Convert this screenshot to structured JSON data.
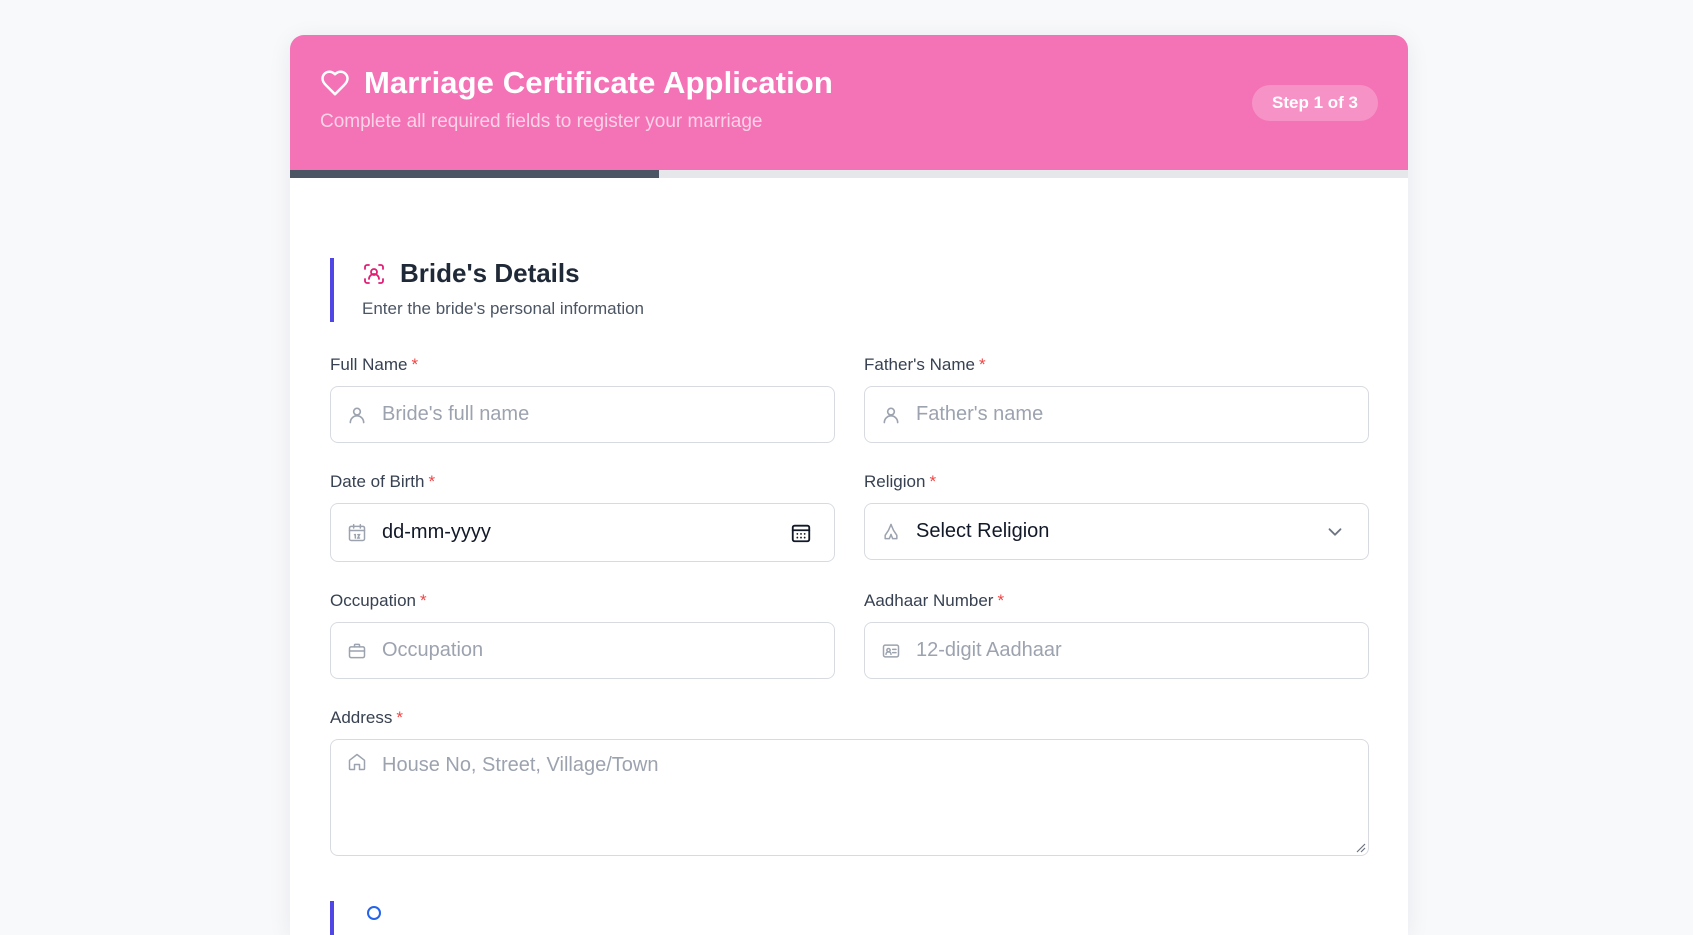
{
  "header": {
    "title": "Marriage Certificate Application",
    "subtitle": "Complete all required fields to register your marriage",
    "step_badge": "Step 1 of 3",
    "progress_fraction": 0.33,
    "colors": {
      "header_bg": "#f472b6",
      "progress_fill": "#4b5563",
      "accent": "#4f46e5"
    },
    "icon": "heart-icon"
  },
  "section": {
    "title": "Bride's Details",
    "subtitle": "Enter the bride's personal information",
    "icon": "user-scan-icon"
  },
  "form": {
    "full_name": {
      "label": "Full Name",
      "required": "*",
      "placeholder": "Bride's full name",
      "icon": "user-icon"
    },
    "fathers_name": {
      "label": "Father's Name",
      "required": "*",
      "placeholder": "Father's name",
      "icon": "user-icon"
    },
    "date_of_birth": {
      "label": "Date of Birth",
      "required": "*",
      "value": "dd-mm-yyyy",
      "icon": "calendar-icon"
    },
    "religion": {
      "label": "Religion",
      "required": "*",
      "selected": "Select Religion",
      "icon": "praying-hands-icon"
    },
    "occupation": {
      "label": "Occupation",
      "required": "*",
      "placeholder": "Occupation",
      "icon": "briefcase-icon"
    },
    "aadhaar": {
      "label": "Aadhaar Number",
      "required": "*",
      "placeholder": "12-digit Aadhaar",
      "icon": "id-card-icon"
    },
    "address": {
      "label": "Address",
      "required": "*",
      "placeholder": "House No, Street, Village/Town",
      "icon": "home-icon"
    }
  }
}
